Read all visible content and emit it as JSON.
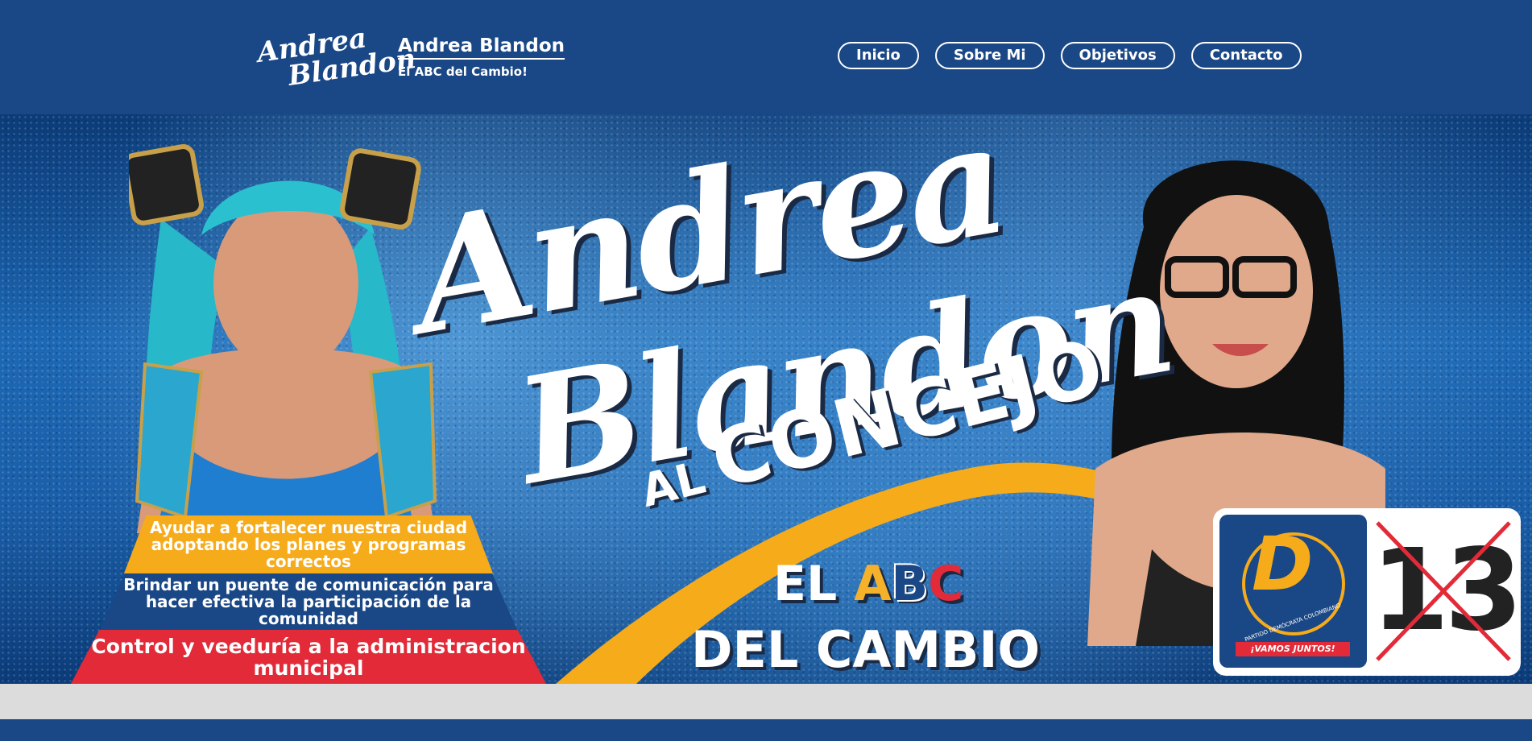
{
  "header": {
    "logo_script_line1": "Andrea",
    "logo_script_line2": "Blandon",
    "brand_title": "Andrea Blandon",
    "brand_subtitle": "El ABC del Cambio!"
  },
  "nav": {
    "items": [
      {
        "label": "Inicio"
      },
      {
        "label": "Sobre Mi"
      },
      {
        "label": "Objetivos"
      },
      {
        "label": "Contacto"
      }
    ]
  },
  "hero": {
    "script_line1": "Andrea",
    "script_line2": "Blandon",
    "al": "AL",
    "concejo": "CONCEJO",
    "abc_prefix": "EL ",
    "abc_a": "A",
    "abc_b": "B",
    "abc_c": "C",
    "del_cambio": "DEL CAMBIO",
    "goals": [
      {
        "text": "Ayudar a fortalecer nuestra ciudad adoptando los planes y programas correctos"
      },
      {
        "text": "Brindar un puente de comunicación para hacer efectiva la participación de la comunidad"
      },
      {
        "text": "Control y veeduría a la administracion municipal"
      }
    ],
    "party": {
      "letter": "D",
      "name": "PARTIDO DEMÓCRATA COLOMBIANO",
      "slogan": "¡VAMOS JUNTOS!",
      "number": "13"
    }
  },
  "colors": {
    "brand_blue": "#1a4785",
    "accent_yellow": "#f6ab1b",
    "accent_red": "#e22a38",
    "light_gray": "#dcdcdc"
  }
}
